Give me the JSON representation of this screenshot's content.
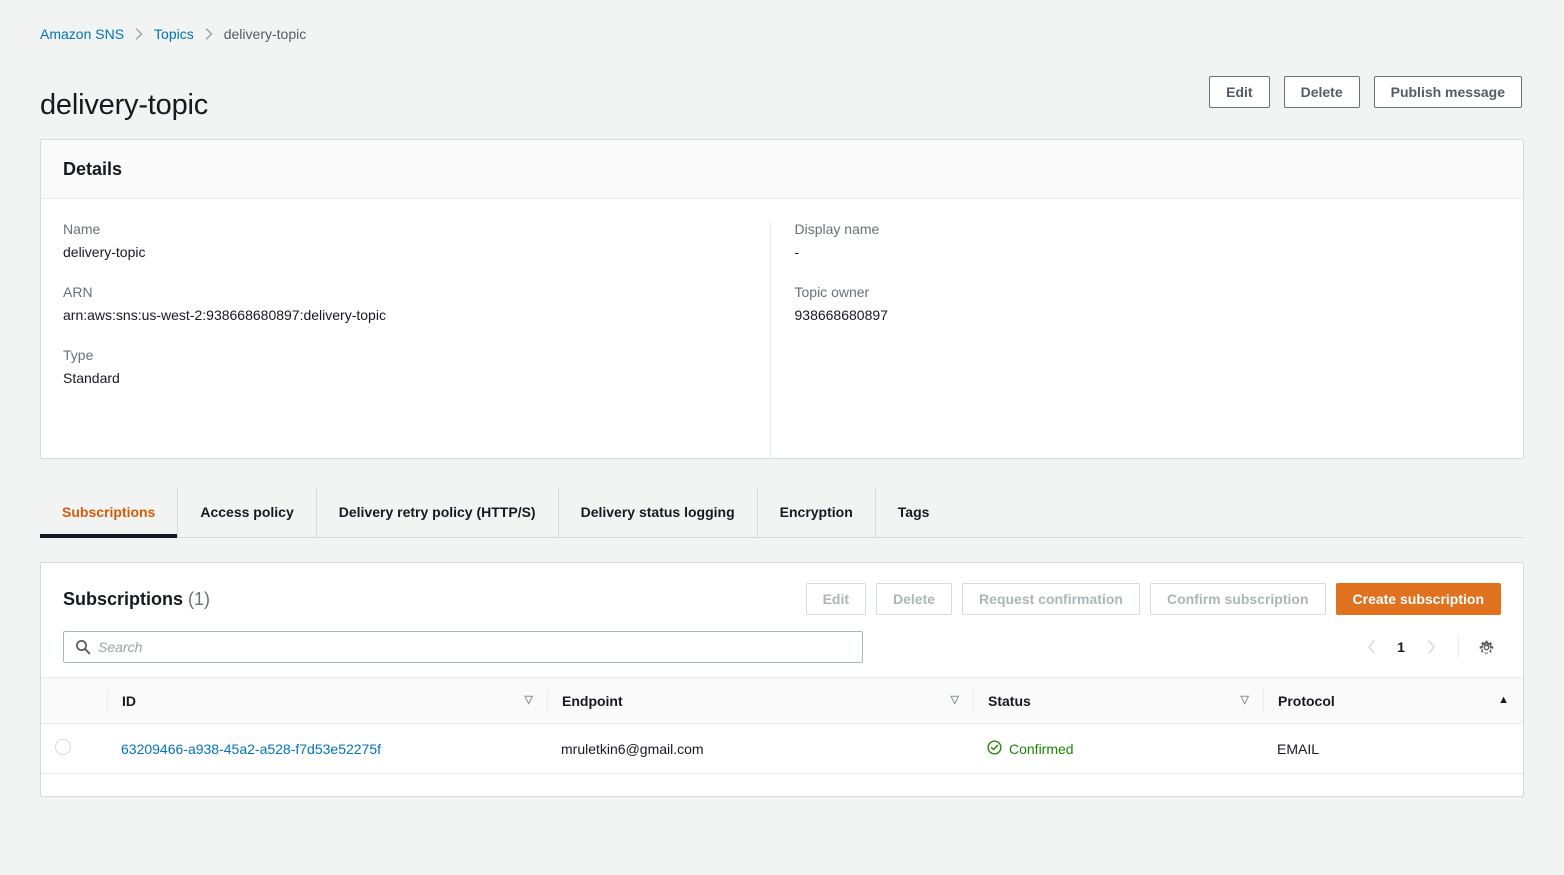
{
  "breadcrumb": {
    "items": [
      {
        "label": "Amazon SNS",
        "type": "link"
      },
      {
        "label": "Topics",
        "type": "link"
      },
      {
        "label": "delivery-topic",
        "type": "current"
      }
    ],
    "separator_icon": "chevron-right-icon"
  },
  "header": {
    "title": "delivery-topic",
    "actions": [
      {
        "label": "Edit",
        "name": "edit-button"
      },
      {
        "label": "Delete",
        "name": "delete-button"
      },
      {
        "label": "Publish message",
        "name": "publish-message-button"
      }
    ]
  },
  "details": {
    "heading": "Details",
    "left": [
      {
        "label": "Name",
        "value": "delivery-topic"
      },
      {
        "label": "ARN",
        "value": "arn:aws:sns:us-west-2:938668680897:delivery-topic"
      },
      {
        "label": "Type",
        "value": "Standard"
      }
    ],
    "right": [
      {
        "label": "Display name",
        "value": "-"
      },
      {
        "label": "Topic owner",
        "value": "938668680897"
      }
    ]
  },
  "tabs": [
    {
      "label": "Subscriptions",
      "active": true
    },
    {
      "label": "Access policy",
      "active": false
    },
    {
      "label": "Delivery retry policy (HTTP/S)",
      "active": false
    },
    {
      "label": "Delivery status logging",
      "active": false
    },
    {
      "label": "Encryption",
      "active": false
    },
    {
      "label": "Tags",
      "active": false
    }
  ],
  "subscriptions": {
    "title": "Subscriptions",
    "count": "(1)",
    "actions": [
      {
        "label": "Edit",
        "name": "subscriptions-edit-button",
        "disabled": true
      },
      {
        "label": "Delete",
        "name": "subscriptions-delete-button",
        "disabled": true
      },
      {
        "label": "Request confirmation",
        "name": "request-confirmation-button",
        "disabled": true
      },
      {
        "label": "Confirm subscription",
        "name": "confirm-subscription-button",
        "disabled": true
      },
      {
        "label": "Create subscription",
        "name": "create-subscription-button",
        "disabled": false
      }
    ],
    "search": {
      "value": "",
      "placeholder": "Search",
      "icon": "search-icon"
    },
    "pagination": {
      "prev_icon": "chevron-left-icon",
      "next_icon": "chevron-right-icon",
      "current_page": "1",
      "settings_icon": "gear-icon"
    },
    "table": {
      "columns": [
        {
          "label": "ID",
          "sort": "idle"
        },
        {
          "label": "Endpoint",
          "sort": "idle"
        },
        {
          "label": "Status",
          "sort": "idle"
        },
        {
          "label": "Protocol",
          "sort": "ascending"
        }
      ],
      "rows": [
        {
          "id": "63209466-a938-45a2-a528-f7d53e52275f",
          "endpoint": "mruletkin6@gmail.com",
          "status": "Confirmed",
          "status_icon": "check-circle-icon",
          "protocol": "EMAIL",
          "selected": false
        }
      ]
    }
  },
  "colors": {
    "accent_orange": "#e0711f",
    "link_blue": "#0073bb",
    "tab_active": "#d45b07",
    "status_green": "#1d8102",
    "page_background": "#f2f3f3"
  }
}
